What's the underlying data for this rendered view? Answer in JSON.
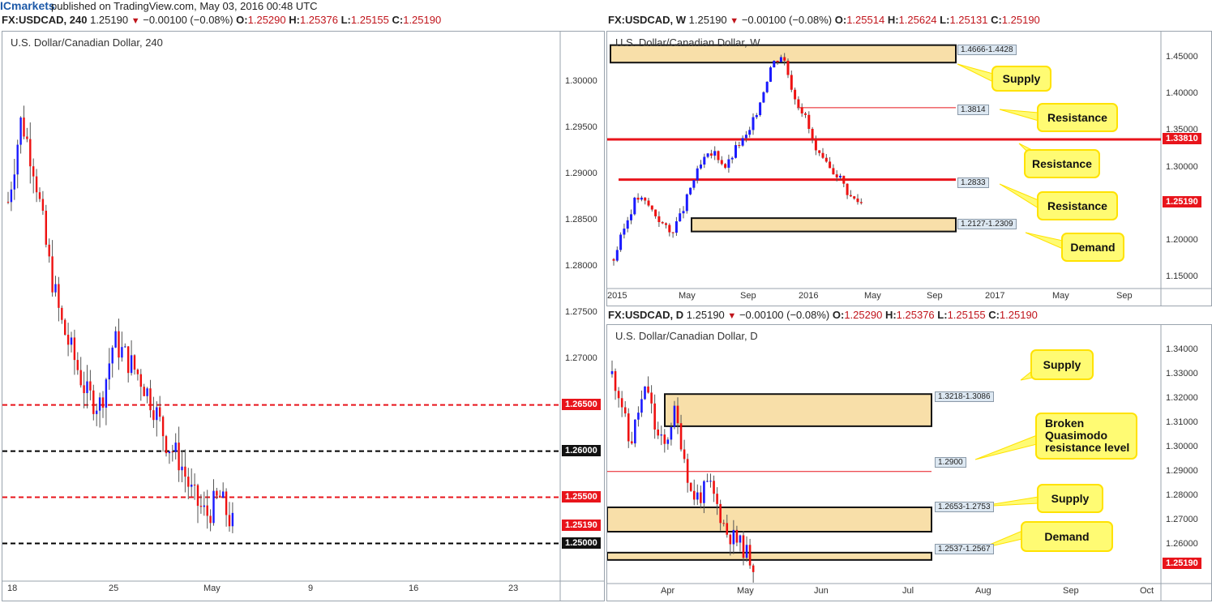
{
  "header": {
    "brand": "ICmarkets",
    "published": "published on TradingView.com, May 03, 2016 00:48 UTC"
  },
  "charts": {
    "h4": {
      "ohlc": {
        "symbol": "FX:USDCAD, 240",
        "last": "1.25190",
        "change": "−0.00100 (−0.08%)",
        "o": "O:",
        "ov": "1.25290",
        "h": "H:",
        "hv": "1.25376",
        "l": "L:",
        "lv": "1.25155",
        "c": "C:",
        "cv": "1.25190"
      },
      "title": "U.S. Dollar/Canadian Dollar, 240",
      "price_ticks": [
        "1.30000",
        "1.29500",
        "1.29000",
        "1.28500",
        "1.28000",
        "1.27500",
        "1.27000",
        "1.26500",
        "1.26000",
        "1.25500",
        "1.25190",
        "1.25000"
      ],
      "x_ticks": [
        "18",
        "25",
        "May",
        "9",
        "16",
        "23"
      ]
    },
    "weekly": {
      "ohlc": {
        "symbol": "FX:USDCAD, W",
        "last": "1.25190",
        "change": "−0.00100 (−0.08%)",
        "o": "O:",
        "ov": "1.25514",
        "h": "H:",
        "hv": "1.25624",
        "l": "L:",
        "lv": "1.25131",
        "c": "C:",
        "cv": "1.25190"
      },
      "title": "U.S. Dollar/Canadian Dollar, W",
      "price_ticks": [
        "1.45000",
        "1.40000",
        "1.35000",
        "1.33810",
        "1.30000",
        "1.25190",
        "1.20000",
        "1.15000"
      ],
      "x_ticks": [
        "2015",
        "May",
        "Sep",
        "2016",
        "May",
        "Sep",
        "2017",
        "May",
        "Sep"
      ],
      "zones": [
        "1.4666-1.4428",
        "1.3814",
        "1.2833",
        "1.2127-1.2309"
      ],
      "callouts": [
        "Supply",
        "Resistance",
        "Resistance",
        "Resistance",
        "Demand"
      ]
    },
    "daily": {
      "ohlc": {
        "symbol": "FX:USDCAD, D",
        "last": "1.25190",
        "change": "−0.00100 (−0.08%)",
        "o": "O:",
        "ov": "1.25290",
        "h": "H:",
        "hv": "1.25376",
        "l": "L:",
        "lv": "1.25155",
        "c": "C:",
        "cv": "1.25190"
      },
      "title": "U.S. Dollar/Canadian Dollar, D",
      "price_ticks": [
        "1.34000",
        "1.33000",
        "1.32000",
        "1.31000",
        "1.30000",
        "1.29000",
        "1.28000",
        "1.27000",
        "1.26000",
        "1.25190"
      ],
      "x_ticks": [
        "Apr",
        "May",
        "Jun",
        "Jul",
        "Aug",
        "Sep",
        "Oct"
      ],
      "zones": [
        "1.3218-1.3086",
        "1.2900",
        "1.2653-1.2753",
        "1.2537-1.2567"
      ],
      "callouts": [
        "Supply",
        "Broken Quasimodo resistance level",
        "Supply",
        "Demand"
      ]
    }
  },
  "chart_data": [
    {
      "type": "candlestick",
      "title": "U.S. Dollar/Canadian Dollar, 240",
      "ylim": [
        1.2475,
        1.3035
      ],
      "levels": [
        {
          "value": 1.265,
          "style": "dashed",
          "color": "#e8141b"
        },
        {
          "value": 1.26,
          "style": "dashed",
          "color": "#000000"
        },
        {
          "value": 1.255,
          "style": "dashed",
          "color": "#e8141b"
        },
        {
          "value": 1.25,
          "style": "dashed",
          "color": "#000000"
        }
      ],
      "last_price": 1.2519
    },
    {
      "type": "candlestick",
      "title": "U.S. Dollar/Canadian Dollar, W",
      "ylim": [
        1.135,
        1.485
      ],
      "zones": [
        {
          "label": "1.4666-1.4428",
          "low": 1.4428,
          "high": 1.4666,
          "from": "2016-01",
          "to": "end"
        },
        {
          "label": "1.2127-1.2309",
          "low": 1.2127,
          "high": 1.2309,
          "from": "2015-05",
          "to": "end"
        }
      ],
      "levels": [
        {
          "label": "1.3814",
          "value": 1.3814,
          "style": "thin"
        },
        {
          "label": "1.3381",
          "value": 1.3381,
          "style": "thick"
        },
        {
          "label": "1.2833",
          "value": 1.2833,
          "style": "thick"
        }
      ],
      "last_price": 1.2519
    },
    {
      "type": "candlestick",
      "title": "U.S. Dollar/Canadian Dollar, D",
      "ylim": [
        1.247,
        1.3455
      ],
      "zones": [
        {
          "label": "1.3218-1.3086",
          "low": 1.3086,
          "high": 1.3218
        },
        {
          "label": "1.2653-1.2753",
          "low": 1.2653,
          "high": 1.2753
        },
        {
          "label": "1.2537-1.2567",
          "low": 1.2537,
          "high": 1.2567
        }
      ],
      "levels": [
        {
          "label": "1.2900",
          "value": 1.29,
          "style": "thin"
        }
      ],
      "last_price": 1.2519
    }
  ]
}
